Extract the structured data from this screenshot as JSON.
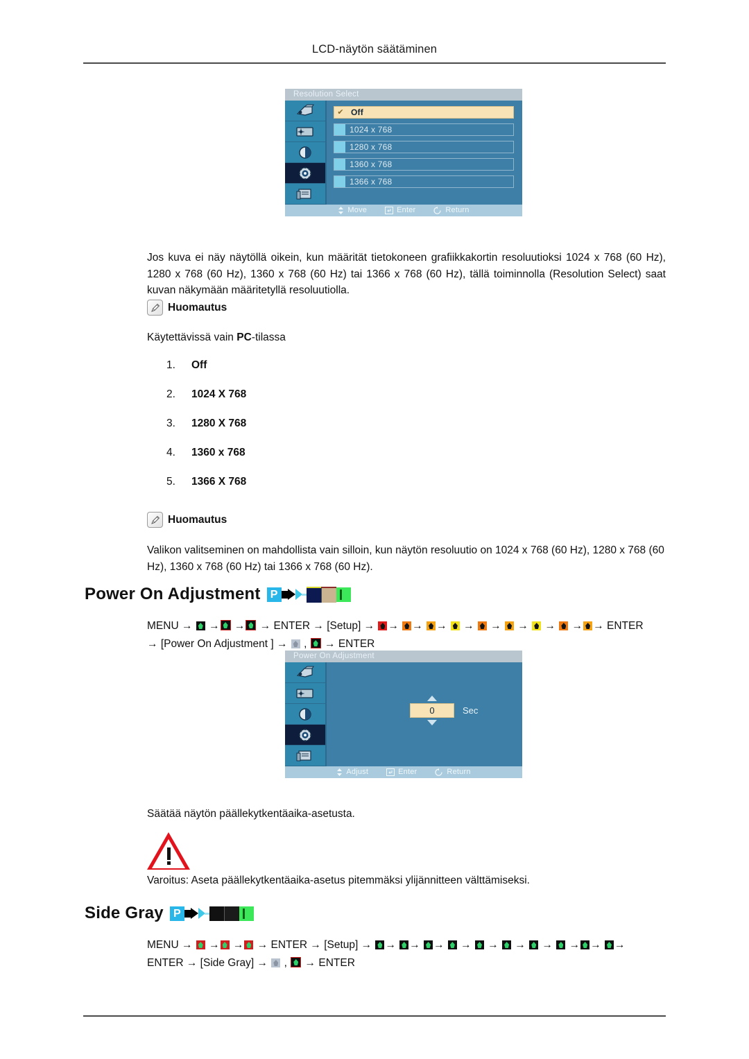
{
  "header": {
    "title": "LCD-näytön säätäminen"
  },
  "osd_resolution": {
    "title": "Resolution Select",
    "options": [
      {
        "label": "Off",
        "selected": true
      },
      {
        "label": "1024 x 768",
        "selected": false
      },
      {
        "label": "1280 x 768",
        "selected": false
      },
      {
        "label": "1360 x 768",
        "selected": false
      },
      {
        "label": "1366 x 768",
        "selected": false
      }
    ],
    "footer": [
      {
        "icon": "move-updown-icon",
        "label": "Move"
      },
      {
        "icon": "enter-key-icon",
        "label": "Enter"
      },
      {
        "icon": "return-arrow-icon",
        "label": "Return"
      }
    ],
    "rail_icons": [
      "picture-icon",
      "screen-icon",
      "contrast-icon",
      "setup-gear-icon",
      "multi-control-icon"
    ],
    "rail_selected_index": 3
  },
  "intro_paragraph": "Jos kuva ei näy näytöllä oikein, kun määrität tietokoneen grafiikkakortin resoluutioksi 1024 x 768 (60 Hz), 1280 x 768 (60 Hz), 1360 x 768 (60 Hz) tai 1366 x 768 (60 Hz), tällä toiminnolla (Resolution Select) saat kuvan näkymään määritetyllä resoluutiolla.",
  "note1": {
    "label": "Huomautus",
    "text_prefix": "Käytettävissä vain ",
    "text_bold": "PC",
    "text_suffix": "-tilassa"
  },
  "resolution_list": [
    {
      "num": "1.",
      "label": "Off"
    },
    {
      "num": "2.",
      "label": "1024 X 768"
    },
    {
      "num": "3.",
      "label": "1280 X 768"
    },
    {
      "num": "4.",
      "label": "1360 x 768"
    },
    {
      "num": "5.",
      "label": "1366 X 768"
    }
  ],
  "note2": {
    "label": "Huomautus",
    "text": "Valikon valitseminen on mahdollista vain silloin, kun näytön resoluutio on 1024 x 768 (60 Hz), 1280 x 768 (60 Hz), 1360 x 768 (60 Hz) tai 1366 x 768 (60 Hz)."
  },
  "section_power_on": {
    "heading": "Power On Adjustment",
    "heading_icons": [
      "p-badge-icon",
      "plug-icon",
      "connector-icon",
      "navy-screen-icon",
      "tan-screen-icon",
      "green-screen-icon"
    ],
    "path_line1": {
      "menu": "MENU",
      "enter1": "ENTER",
      "setup": "[Setup]",
      "enter2": "ENTER",
      "icons_before_enter1": [
        "mi-dark",
        "mi-greenb",
        "mi-greenb"
      ],
      "icons_after_setup": [
        "mi-red",
        "mi-orange",
        "mi-amber",
        "mi-yellow",
        "mi-orange",
        "mi-amber",
        "mi-yellow",
        "mi-orange",
        "mi-amber"
      ]
    },
    "path_line2": {
      "item": "[Power On Adjustment ]",
      "icons": [
        "mi-gray",
        "mi-greenb"
      ],
      "enter": "ENTER"
    }
  },
  "osd_power_on": {
    "title": "Power On Adjustment",
    "value": "0",
    "unit": "Sec",
    "up_arrow": "increase-arrow-icon",
    "down_arrow": "decrease-arrow-icon",
    "footer": [
      {
        "icon": "adjust-updown-icon",
        "label": "Adjust"
      },
      {
        "icon": "enter-key-icon",
        "label": "Enter"
      },
      {
        "icon": "return-arrow-icon",
        "label": "Return"
      }
    ],
    "rail_icons": [
      "picture-icon",
      "screen-icon",
      "contrast-icon",
      "setup-gear-icon",
      "multi-control-icon"
    ],
    "rail_selected_index": 3
  },
  "power_on_caption": "Säätää näytön päällekytkentäaika-asetusta.",
  "warning": {
    "icon": "warning-triangle-icon",
    "text": "Varoitus: Aseta päällekytkentäaika-asetus pitemmäksi ylijännitteen välttämiseksi."
  },
  "section_side_gray": {
    "heading": "Side Gray",
    "heading_icons": [
      "p-badge-icon",
      "plug-icon",
      "connector-icon",
      "dark-screen-icon",
      "dark-screen2-icon",
      "green-screen-icon"
    ],
    "path_line1": {
      "menu": "MENU",
      "enter1": "ENTER",
      "setup": "[Setup]",
      "icons_before_enter1": [
        "mi-redgrn",
        "mi-redgrn",
        "mi-redgrn"
      ],
      "icons_after_setup": [
        "mi-dark",
        "mi-dark",
        "mi-dark",
        "mi-dark",
        "mi-dark",
        "mi-dark",
        "mi-dark",
        "mi-dark",
        "mi-dark",
        "mi-dark"
      ]
    },
    "path_line2": {
      "enter1": "ENTER",
      "item": "[Side Gray]",
      "icons": [
        "mi-gray",
        "mi-greenb"
      ],
      "enter2": "ENTER"
    }
  },
  "colors": {
    "osd_panel": "#3d7fa6",
    "osd_rail": "#2f87ad",
    "osd_selected_rail": "#0e1d3c",
    "osd_highlight": "#f7e3b5",
    "warning_red": "#e1131d",
    "badge_blue": "#29b6e8"
  }
}
